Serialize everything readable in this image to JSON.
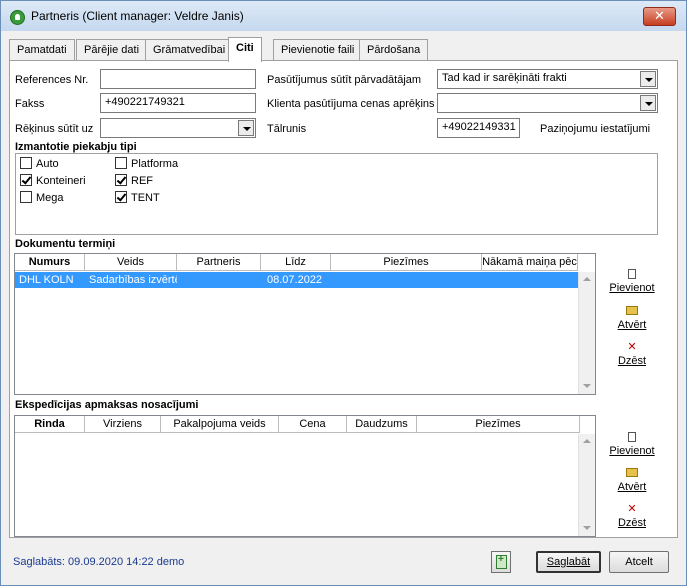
{
  "window": {
    "title": "Partneris (Client manager: Veldre Janis)",
    "close_label": "✕"
  },
  "tabs": [
    {
      "label": "Pamatdati"
    },
    {
      "label": "Pārējie dati"
    },
    {
      "label": "Grāmatvedībai"
    },
    {
      "label": "Citi"
    },
    {
      "label": "Pievienotie faili"
    },
    {
      "label": "Pārdošana"
    }
  ],
  "form": {
    "references_label": "References Nr.",
    "references_value": "",
    "fakss_label": "Fakss",
    "fakss_value": "+490221749321",
    "rekinus_label": "Rēķinus sūtīt uz",
    "rekinus_value": "",
    "pasutijumus_label": "Pasūtījumus sūtīt pārvadātājam",
    "pasutijumus_value": "Tad kad ir sarēķināti frakti",
    "cenas_label": "Klienta pasūtījuma cenas aprēķins",
    "cenas_value": "",
    "talrunis_label": "Tālrunis",
    "talrunis_value": "+49022149331",
    "pazinojumu_label": "Paziņojumu iestatījumi"
  },
  "trailers": {
    "title": "Izmantotie piekabju tipi",
    "items": [
      {
        "label": "Auto",
        "checked": false
      },
      {
        "label": "Konteineri",
        "checked": true
      },
      {
        "label": "Mega",
        "checked": false
      },
      {
        "label": "Platforma",
        "checked": false
      },
      {
        "label": "REF",
        "checked": true
      },
      {
        "label": "TENT",
        "checked": true
      }
    ]
  },
  "documents": {
    "title": "Dokumentu termiņi",
    "columns": [
      "Numurs",
      "Veids",
      "Partneris",
      "",
      "Līdz",
      "Piezīmes",
      "Nākamā maiņa pēc"
    ],
    "rows": [
      {
        "numurs": "DHL KOLN",
        "veids": "Sadarbības izvērtē:",
        "partneris": "",
        "lidz": "08.07.2022",
        "piezimes": "",
        "nakama": ""
      }
    ]
  },
  "payment": {
    "title": "Ekspedīcijas apmaksas nosacījumi",
    "columns": [
      "Rinda",
      "Virziens",
      "Pakalpojuma veids",
      "Cena",
      "Daudzums",
      "Piezīmes"
    ]
  },
  "actions": {
    "add_label": "Pievienot",
    "open_label": "Atvērt",
    "delete_label": "Dzēst"
  },
  "footer": {
    "status": "Saglabāts: 09.09.2020 14:22 demo",
    "save_label": "Saglabāt",
    "cancel_label": "Atcelt"
  }
}
